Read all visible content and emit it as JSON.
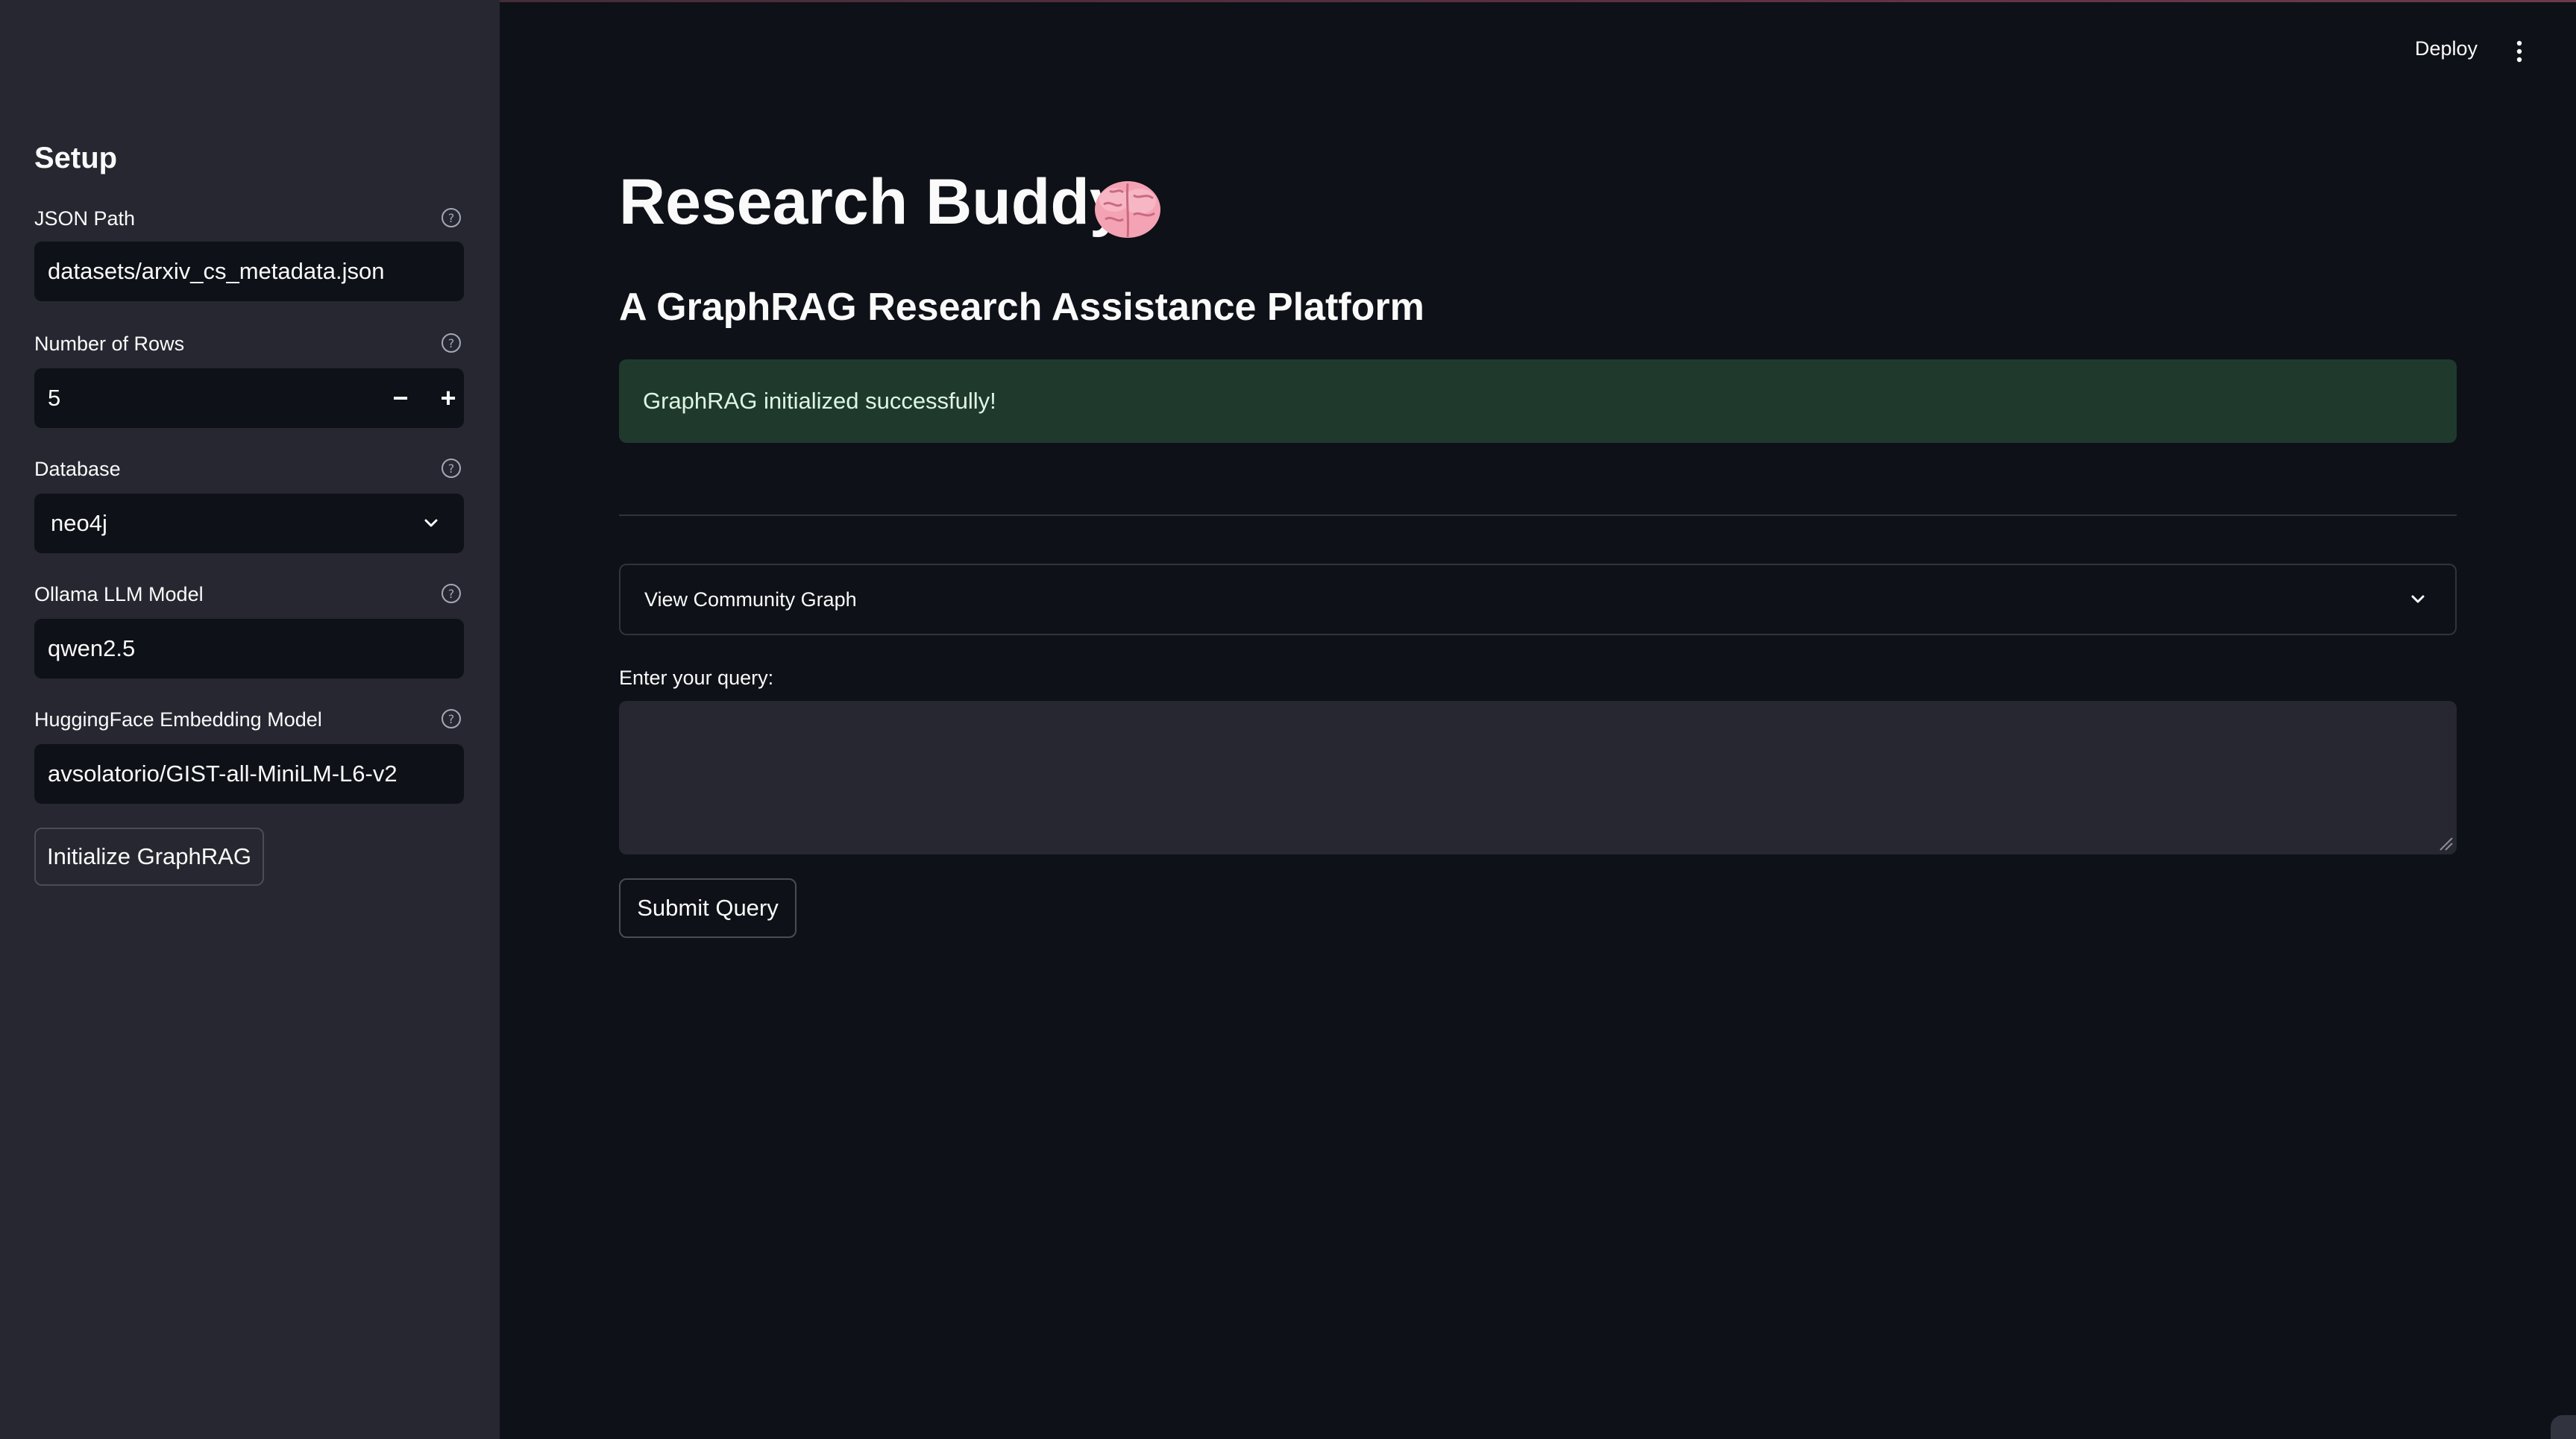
{
  "header": {
    "deploy_label": "Deploy",
    "menu_icon": "kebab-menu-icon"
  },
  "sidebar": {
    "title": "Setup",
    "fields": {
      "json_path": {
        "label": "JSON Path",
        "value": "datasets/arxiv_cs_metadata.json"
      },
      "num_rows": {
        "label": "Number of Rows",
        "value": "5",
        "decrement": "−",
        "increment": "+"
      },
      "database": {
        "label": "Database",
        "value": "neo4j"
      },
      "llm_model": {
        "label": "Ollama LLM Model",
        "value": "qwen2.5"
      },
      "embedding_model": {
        "label": "HuggingFace Embedding Model",
        "value": "avsolatorio/GIST-all-MiniLM-L6-v2"
      }
    },
    "init_button_label": "Initialize GraphRAG"
  },
  "main": {
    "title": "Research Buddy",
    "title_icon": "brain-icon",
    "subtitle": "A GraphRAG Research Assistance Platform",
    "success_message": "GraphRAG initialized successfully!",
    "expander_label": "View Community Graph",
    "query_label": "Enter your query:",
    "query_value": "",
    "submit_label": "Submit Query"
  },
  "colors": {
    "background": "#0e1117",
    "sidebar": "#262730",
    "success_bg": "#1f3a2d",
    "text": "#fafafa"
  }
}
